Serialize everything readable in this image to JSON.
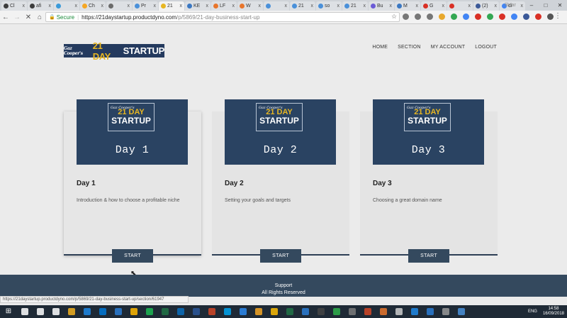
{
  "browser": {
    "tabs": [
      {
        "label": "Cl",
        "color": "#3c3c3c"
      },
      {
        "label": "afi",
        "color": "#3c3c3c"
      },
      {
        "label": "",
        "color": "#3b9ad9"
      },
      {
        "label": "Ch",
        "color": "#f5a623"
      },
      {
        "label": "",
        "color": "#6b6b6b"
      },
      {
        "label": "Pr",
        "color": "#4a90d9"
      },
      {
        "label": "21",
        "color": "#e7b622",
        "active": true
      },
      {
        "label": "KE",
        "color": "#3b78c2"
      },
      {
        "label": "LF",
        "color": "#e8762c"
      },
      {
        "label": "W",
        "color": "#e8762c"
      },
      {
        "label": "",
        "color": "#4a90d9"
      },
      {
        "label": "21",
        "color": "#4a90d9"
      },
      {
        "label": "so",
        "color": "#4a90d9"
      },
      {
        "label": "21",
        "color": "#4a90d9"
      },
      {
        "label": "Bu",
        "color": "#6b5bd6"
      },
      {
        "label": "M",
        "color": "#3b78c2"
      },
      {
        "label": "G",
        "color": "#d93025"
      },
      {
        "label": "",
        "color": "#d93025"
      },
      {
        "label": "(2)",
        "color": "#3b5998"
      },
      {
        "label": "di",
        "color": "#4285f4"
      }
    ],
    "tab_close": "x",
    "window_user": "librar",
    "window_min": "–",
    "window_max": "□",
    "window_close": "✕",
    "url_secure": "Secure",
    "url_host": "https://21daystartup.productdyno.com",
    "url_path": "/p/5869/21-day-business-start-up",
    "extension_colors": [
      "#777",
      "#777",
      "#777",
      "#e8a82c",
      "#34a853",
      "#4285f4",
      "#d93025",
      "#34a853",
      "#d93025",
      "#4285f4",
      "#3b5998",
      "#d93025",
      "#555"
    ]
  },
  "site": {
    "logo_script": "Gaz Cooper's",
    "logo_day": "21 DAY",
    "logo_startup": "STARTUP",
    "nav": [
      "HOME",
      "SECTION",
      "MY ACCOUNT",
      "LOGOUT"
    ]
  },
  "cards": [
    {
      "thumb_day": "21 DAY",
      "thumb_startup": "STARTUP",
      "thumb_sig": "Gaz Cooper's",
      "thumb_label": "Day 1",
      "title": "Day 1",
      "description": "Introduction & how to choose a profitable niche",
      "button": "START"
    },
    {
      "thumb_day": "21 DAY",
      "thumb_startup": "STARTUP",
      "thumb_sig": "Gaz Cooper's",
      "thumb_label": "Day 2",
      "title": "Day 2",
      "description": "Setting your goals and targets",
      "button": "START"
    },
    {
      "thumb_day": "21 DAY",
      "thumb_startup": "STARTUP",
      "thumb_sig": "Gaz Cooper's",
      "thumb_label": "Day 3",
      "title": "Day 3",
      "description": "Choosing a great domain name",
      "button": "START"
    }
  ],
  "footer": {
    "line1": "Support",
    "line2": "All Rights Reserved"
  },
  "status_url": "https://21daystartup.productdyno.com/p/5869/21-day-business-start-up/section/61947",
  "taskbar": {
    "icons": [
      "#ffffff",
      "#ffffff",
      "#ffffff",
      "#ffffff",
      "#f2b01e",
      "#1e88e5",
      "#0078d7",
      "#2b7cd3",
      "#ffb900",
      "#1db954",
      "#217346",
      "#0a6ebd",
      "#2b579a",
      "#d24726",
      "#00a4ef",
      "#2d89ef",
      "#f5a623",
      "#fbbc05",
      "#217346",
      "#2b7cd3",
      "#444444",
      "#2fb04b",
      "#7b7b7b",
      "#d24726",
      "#e8762c",
      "#cccccc",
      "#1e88e5",
      "#2b7cd3",
      "#999999",
      "#4a90d9"
    ],
    "lang": "ENG",
    "time": "14:58",
    "date": "16/09/2018"
  }
}
